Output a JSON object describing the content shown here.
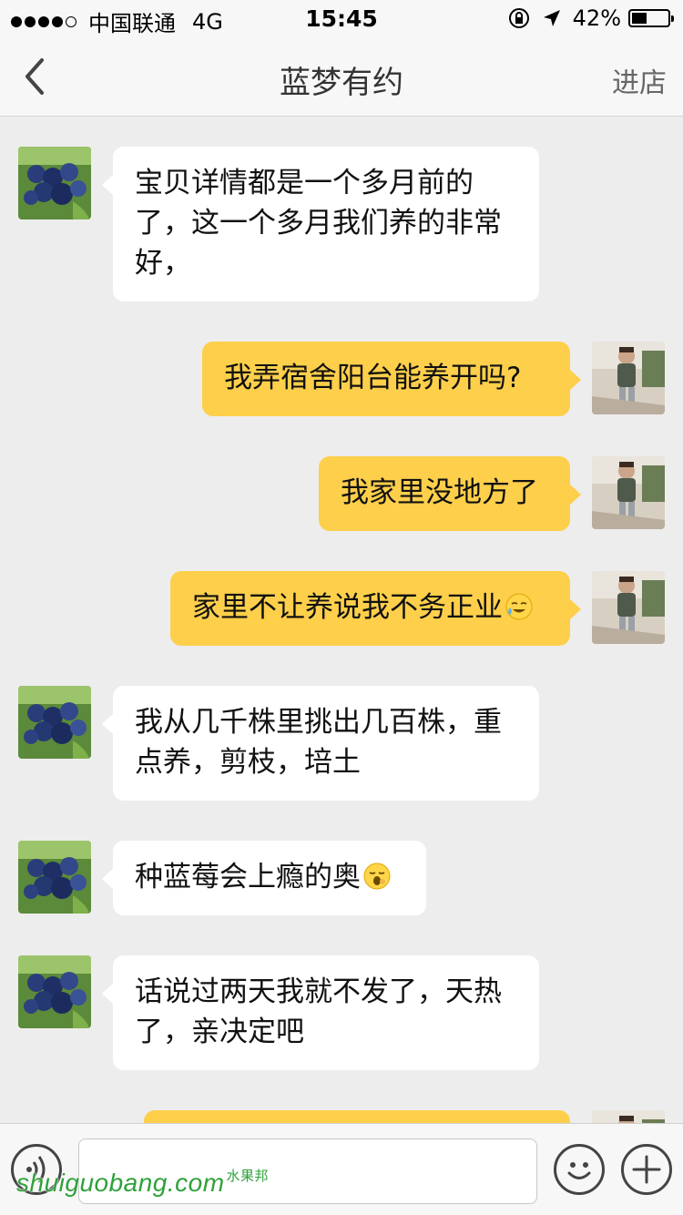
{
  "status_bar": {
    "carrier": "中国联通",
    "network": "4G",
    "time": "15:45",
    "battery_text": "42%",
    "battery_level": 0.42,
    "signal_bars_filled": 4,
    "signal_bars_total": 5
  },
  "nav": {
    "back_icon": "chevron-left-icon",
    "title": "蓝梦有约",
    "right_label": "进店"
  },
  "messages": [
    {
      "from": "shop",
      "text": "宝贝详情都是一个多月前的了，这一个多月我们养的非常好，"
    },
    {
      "from": "me",
      "text": "我弄宿舍阳台能养开吗?"
    },
    {
      "from": "me",
      "text": "我家里没地方了"
    },
    {
      "from": "me",
      "text": "家里不让养说我不务正业",
      "emoji": "sweat-smile-emoji"
    },
    {
      "from": "shop",
      "text": "我从几千株里挑出几百株，重点养，剪枝，培土"
    },
    {
      "from": "shop",
      "text": "种蓝莓会上瘾的奥",
      "emoji": "yawn-emoji"
    },
    {
      "from": "shop",
      "text": "话说过两天我就不发了，天热了，亲决定吧"
    },
    {
      "from": "me",
      "text": ""
    }
  ],
  "input_bar": {
    "voice_icon": "voice-icon",
    "text_value": "",
    "emoji_icon": "smiley-icon",
    "plus_icon": "plus-icon"
  },
  "watermark": {
    "text": "shuiguobang.com",
    "small_text": "水果邦"
  },
  "colors": {
    "outgoing_bubble": "#fdcf4b",
    "incoming_bubble": "#ffffff",
    "background": "#ededed",
    "watermark": "#2fa13a"
  }
}
